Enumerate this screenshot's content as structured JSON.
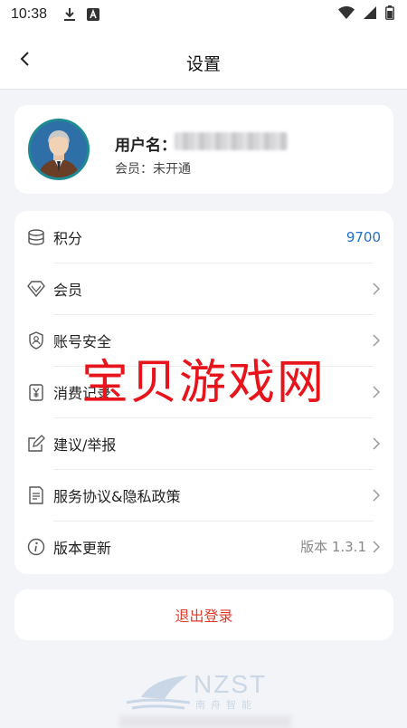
{
  "status_bar": {
    "time": "10:38"
  },
  "header": {
    "title": "设置"
  },
  "profile": {
    "username_label": "用户名：",
    "member_status": "会员：未开通"
  },
  "menu": {
    "items": [
      {
        "label": "积分",
        "value": "9700",
        "icon": "coins-icon"
      },
      {
        "label": "会员",
        "icon": "diamond-icon"
      },
      {
        "label": "账号安全",
        "icon": "shield-user-icon"
      },
      {
        "label": "消费记录",
        "icon": "receipt-yen-icon"
      },
      {
        "label": "建议/举报",
        "icon": "edit-icon"
      },
      {
        "label": "服务协议&隐私政策",
        "icon": "document-icon"
      },
      {
        "label": "版本更新",
        "value": "版本 1.3.1",
        "icon": "info-icon"
      }
    ]
  },
  "logout_label": "退出登录",
  "watermark": "宝贝游戏网",
  "footer": {
    "brand": "NZST",
    "brand_cn": "南舟智能"
  },
  "colors": {
    "accent_blue": "#1e6fcf",
    "logout_red": "#e23b2c",
    "watermark_red": "#e8141c"
  }
}
